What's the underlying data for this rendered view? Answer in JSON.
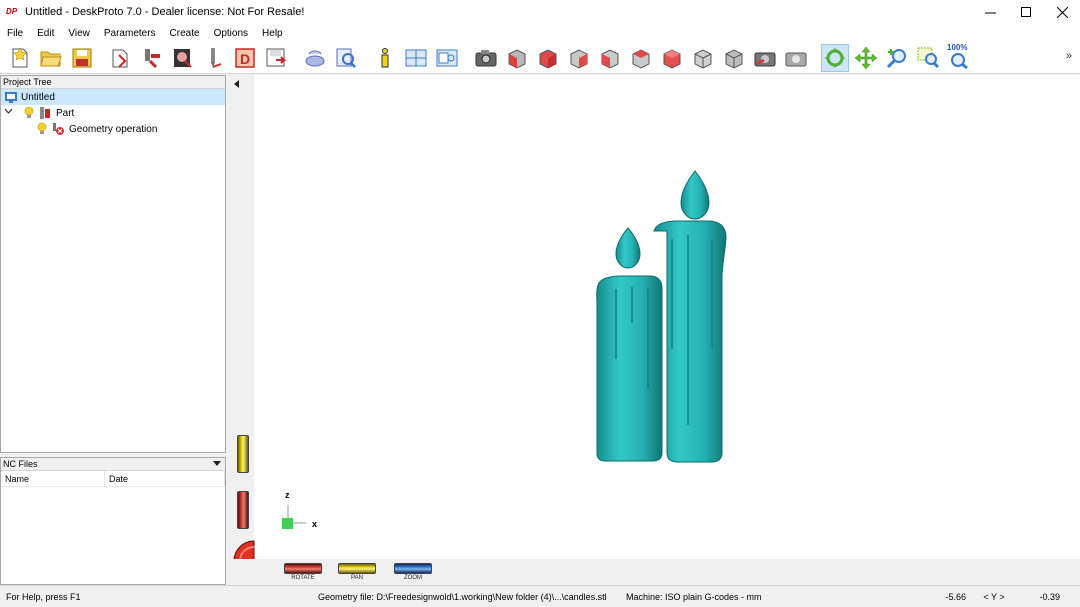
{
  "window": {
    "app_icon_text": "DP",
    "title": "Untitled - DeskProto 7.0 - Dealer license: Not For Resale!",
    "controls": [
      "minimize-icon",
      "maximize-icon",
      "close-icon"
    ]
  },
  "menu": {
    "items": [
      "File",
      "Edit",
      "View",
      "Parameters",
      "Create",
      "Options",
      "Help"
    ]
  },
  "toolbar": {
    "buttons": [
      "new-icon",
      "open-icon",
      "save-icon",
      "part-icon",
      "operation-icon",
      "drawing-icon",
      "tool-icon",
      "toolpath-icon",
      "export-icon",
      "simulate-icon",
      "preview-icon",
      "info-icon",
      "layout-icon",
      "window-icon",
      "camera-icon",
      "view-front-icon",
      "view-back-icon",
      "view-left-icon",
      "view-right-icon",
      "view-top-icon",
      "view-bottom-icon",
      "view-iso-icon",
      "view-iso2-icon",
      "snapshot-icon",
      "snapshot2-icon",
      "rotate-icon",
      "pan-icon",
      "zoom-icon",
      "zoom-window-icon",
      "zoom-100-icon"
    ],
    "zoom_100_label": "100%",
    "more": "»",
    "active": "rotate-icon"
  },
  "project_tree": {
    "header": "Project Tree",
    "items": [
      {
        "label": "Untitled",
        "level": 0,
        "selected": true
      },
      {
        "label": "Part",
        "level": 1,
        "expanded": true
      },
      {
        "label": "Geometry operation",
        "level": 2
      }
    ]
  },
  "nc_files": {
    "header": "NC Files",
    "columns": [
      "Name",
      "Date"
    ],
    "rows": []
  },
  "viewport": {
    "model": "candles",
    "model_color": "#2ab8b8",
    "axes": {
      "z": "z",
      "x": "x"
    },
    "wheels": {
      "rotate_label": "ROTATE",
      "pan_label": "PAN",
      "zoom_label": "ZOOM"
    }
  },
  "status": {
    "help": "For Help, press F1",
    "geometry": "Geometry file: D:\\Freedesignwold\\1.working\\New folder (4)\\...\\candles.stl",
    "machine": "Machine: ISO plain G-codes - mm",
    "x_value": "-5.66",
    "axis": "< Y >",
    "y_value": "-0.39"
  }
}
